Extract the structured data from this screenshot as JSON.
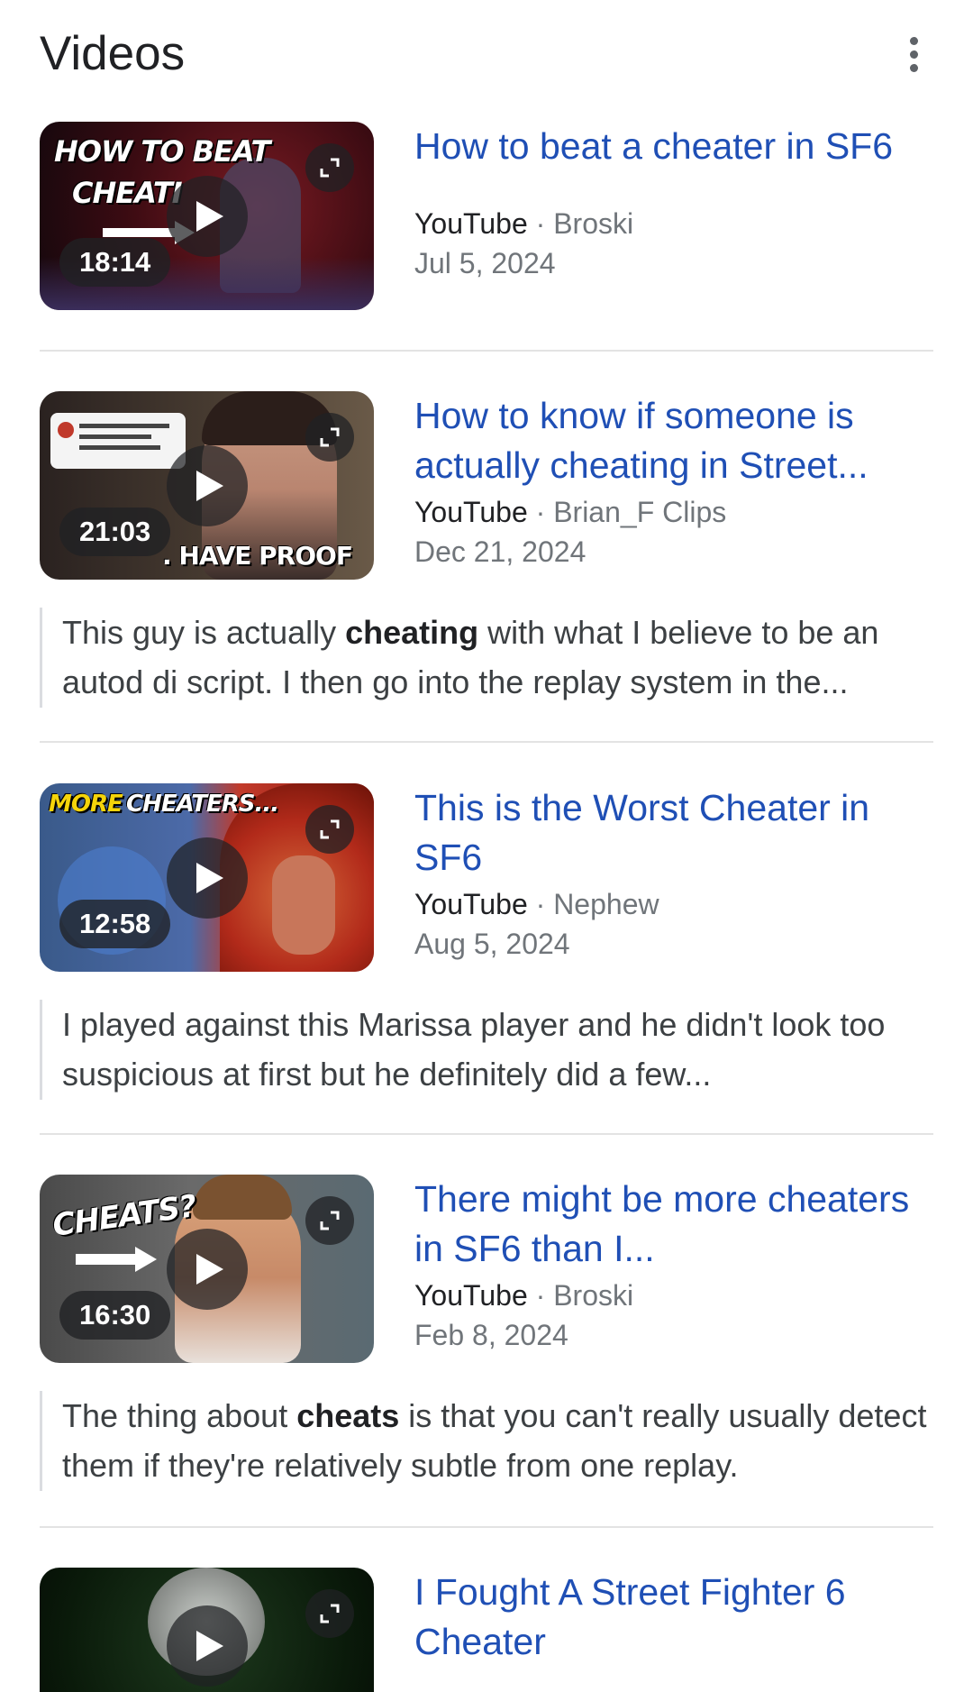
{
  "header": {
    "title": "Videos"
  },
  "icons": {
    "more": "more-vert-icon",
    "play": "play-icon",
    "expand": "expand-icon"
  },
  "colors": {
    "link": "#1f4fb5",
    "text": "#202124",
    "secondary": "#70757a",
    "divider": "#e3e3e3"
  },
  "videos": [
    {
      "title": "How to beat a cheater in SF6",
      "source": "YouTube",
      "channel": "Broski",
      "date": "Jul 5, 2024",
      "duration": "18:14",
      "thumb_text": [
        "HOW TO BEAT",
        "CHEATI"
      ],
      "snippet": null
    },
    {
      "title": "How to know if someone is actually cheating in Street...",
      "source": "YouTube",
      "channel": "Brian_F Clips",
      "date": "Dec 21, 2024",
      "duration": "21:03",
      "thumb_text": [
        ". HAVE PROOF"
      ],
      "snippet": {
        "before": "This guy is actually ",
        "bold": "cheating",
        "after": " with what I believe to be an autod di script. I then go into the replay system in the..."
      }
    },
    {
      "title": "This is the Worst Cheater in SF6",
      "source": "YouTube",
      "channel": "Nephew",
      "date": "Aug 5, 2024",
      "duration": "12:58",
      "thumb_text": [
        "MORE",
        "CHEATERS..."
      ],
      "snippet": {
        "before": "I played against this Marissa player and he didn't look too suspicious at first but he definitely did a few...",
        "bold": "",
        "after": ""
      }
    },
    {
      "title": "There might be more cheaters in SF6 than I...",
      "source": "YouTube",
      "channel": "Broski",
      "date": "Feb 8, 2024",
      "duration": "16:30",
      "thumb_text": [
        "CHEATS?"
      ],
      "snippet": {
        "before": "The thing about ",
        "bold": "cheats",
        "after": " is that you can't really usually detect them if they're relatively subtle from one replay."
      }
    },
    {
      "title": "I Fought A Street Fighter 6 Cheater",
      "source": "",
      "channel": "",
      "date": "",
      "duration": "",
      "thumb_text": [],
      "snippet": null
    }
  ]
}
